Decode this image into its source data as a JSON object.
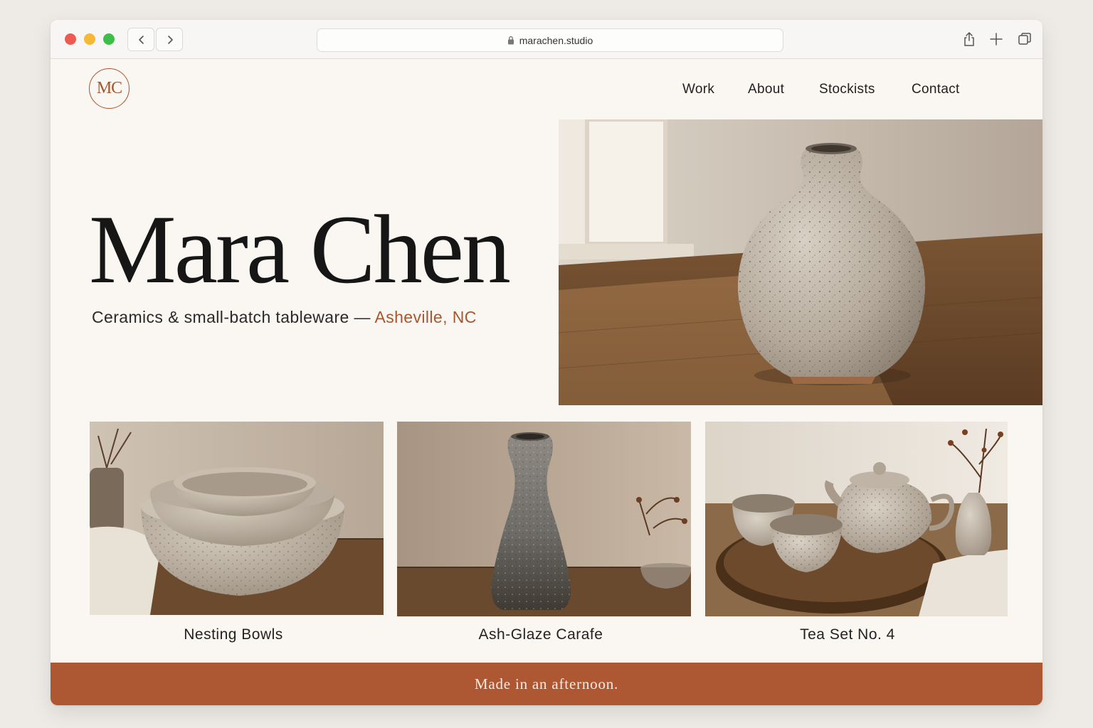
{
  "browser": {
    "url": "marachen.studio",
    "icons": [
      "back-arrow-icon",
      "forward-arrow-icon",
      "lock-icon",
      "share-icon",
      "new-tab-icon",
      "tabs-overview-icon"
    ]
  },
  "site": {
    "logo_text": "MC",
    "nav": [
      "Work",
      "About",
      "Stockists",
      "Contact"
    ],
    "hero": {
      "title": "Mara Chen",
      "subtitle": "Ceramics & small-batch tableware — ",
      "location": "Asheville, NC"
    },
    "works": [
      {
        "title": "Nesting Bowls"
      },
      {
        "title": "Ash-Glaze Carafe"
      },
      {
        "title": "Tea Set No. 4"
      }
    ],
    "footer_text": "Made in an afternoon."
  },
  "colors": {
    "accent": "#ad5733",
    "background": "#faf7f2",
    "text": "#161616"
  }
}
